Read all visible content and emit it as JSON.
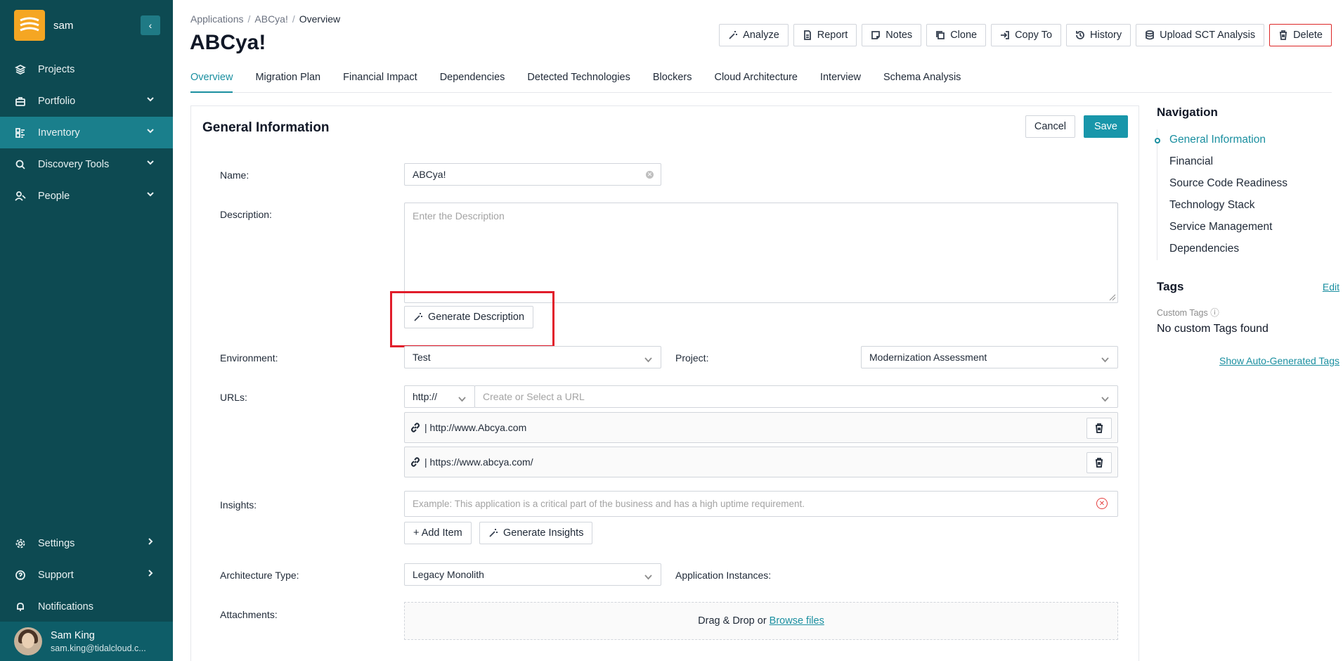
{
  "sidebar": {
    "org_name": "sam",
    "collapse_icon": "chevron-left-icon",
    "items": [
      {
        "label": "Projects",
        "icon": "layers-icon"
      },
      {
        "label": "Portfolio",
        "icon": "briefcase-icon"
      },
      {
        "label": "Inventory",
        "icon": "inventory-icon",
        "active": true
      },
      {
        "label": "Discovery Tools",
        "icon": "search-icon"
      },
      {
        "label": "People",
        "icon": "people-icon"
      }
    ],
    "bottom_items": [
      {
        "label": "Settings",
        "icon": "gear-icon"
      },
      {
        "label": "Support",
        "icon": "help-icon"
      },
      {
        "label": "Notifications",
        "icon": "bell-icon"
      }
    ],
    "user": {
      "name": "Sam King",
      "email": "sam.king@tidalcloud.c..."
    }
  },
  "breadcrumb": {
    "items": [
      "Applications",
      "ABCya!",
      "Overview"
    ]
  },
  "page_title": "ABCya!",
  "actions": {
    "analyze": "Analyze",
    "report": "Report",
    "notes": "Notes",
    "clone": "Clone",
    "copy_to": "Copy To",
    "history": "History",
    "upload_sct": "Upload SCT Analysis",
    "delete": "Delete"
  },
  "tabs": [
    "Overview",
    "Migration Plan",
    "Financial Impact",
    "Dependencies",
    "Detected Technologies",
    "Blockers",
    "Cloud Architecture",
    "Interview",
    "Schema Analysis"
  ],
  "form": {
    "title": "General Information",
    "cancel": "Cancel",
    "save": "Save",
    "name_label": "Name:",
    "name_value": "ABCya!",
    "description_label": "Description:",
    "description_placeholder": "Enter the Description",
    "generate_description": "Generate Description",
    "environment_label": "Environment:",
    "environment_value": "Test",
    "project_label": "Project:",
    "project_value": "Modernization Assessment",
    "urls_label": "URLs:",
    "url_protocol": "http://",
    "url_placeholder": "Create or Select a URL",
    "urls": [
      "| http://www.Abcya.com",
      "| https://www.abcya.com/"
    ],
    "insights_label": "Insights:",
    "insights_placeholder": "Example: This application is a critical part of the business and has a high uptime requirement.",
    "add_item": "+ Add Item",
    "generate_insights": "Generate Insights",
    "architecture_label": "Architecture Type:",
    "architecture_value": "Legacy Monolith",
    "app_instances_label": "Application Instances:",
    "attachments_label": "Attachments:",
    "dropzone_text": "Drag & Drop or",
    "browse_files": "Browse files"
  },
  "right_panel": {
    "nav_title": "Navigation",
    "anchors": [
      "General Information",
      "Financial",
      "Source Code Readiness",
      "Technology Stack",
      "Service Management",
      "Dependencies"
    ],
    "tags_title": "Tags",
    "edit": "Edit",
    "custom_tags_label": "Custom Tags ⓘ",
    "no_tags": "No custom Tags found",
    "auto_tags": "Show Auto-Generated Tags"
  },
  "colors": {
    "sidebar_bg": "#0d4a52",
    "accent": "#1a8fa0",
    "save_bg": "#1896aa",
    "highlight": "#e11d2b",
    "delete_border": "#dc2626"
  }
}
